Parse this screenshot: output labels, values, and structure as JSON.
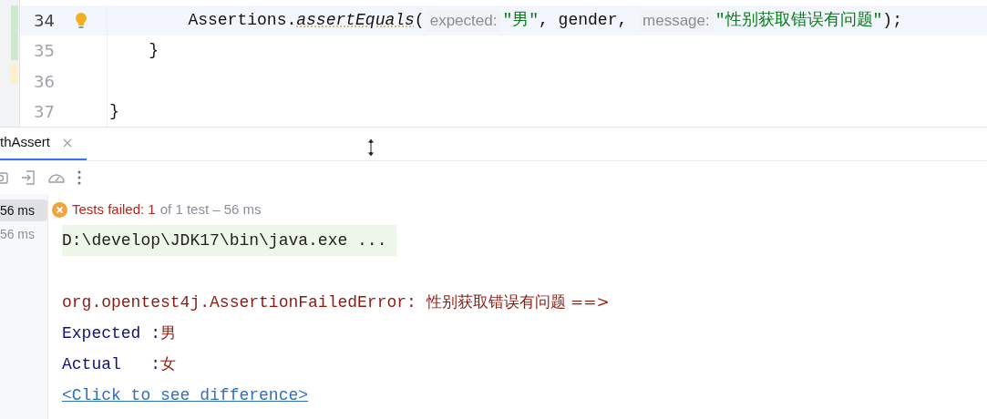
{
  "editor": {
    "lines": [
      {
        "number": "34",
        "current": true,
        "bulb": true,
        "tokens": [
          {
            "kind": "plain",
            "text": "        Assertions."
          },
          {
            "kind": "method",
            "text": "assertEquals"
          },
          {
            "kind": "plain",
            "text": "("
          },
          {
            "kind": "hint",
            "text": "expected:"
          },
          {
            "kind": "string",
            "text": "\"男\""
          },
          {
            "kind": "plain",
            "text": ", gender, "
          },
          {
            "kind": "hint",
            "text": "message:"
          },
          {
            "kind": "string",
            "text": "\"性别获取错误有问题\""
          },
          {
            "kind": "plain",
            "text": ");"
          }
        ]
      },
      {
        "number": "35",
        "current": false,
        "bulb": false,
        "tokens": [
          {
            "kind": "plain",
            "text": "    }"
          }
        ]
      },
      {
        "number": "36",
        "current": false,
        "bulb": false
      },
      {
        "number": "37",
        "current": false,
        "bulb": false,
        "tokens": [
          {
            "kind": "plain",
            "text": "}"
          }
        ]
      }
    ]
  },
  "run_panel": {
    "tabs": [
      {
        "label": "thAssert",
        "selected": true
      }
    ],
    "tree": [
      {
        "time": "56 ms",
        "selected": true
      },
      {
        "time": "56 ms",
        "selected": false
      }
    ],
    "status": {
      "failed": "Tests failed: 1",
      "rest": "of 1 test – 56 ms"
    },
    "console": [
      {
        "kind": "command",
        "text": "D:\\develop\\JDK17\\bin\\java.exe ..."
      },
      {
        "kind": "blank"
      },
      {
        "kind": "error",
        "text": "org.opentest4j.AssertionFailedError: ",
        "message": "性别获取错误有问题 ==>"
      },
      {
        "kind": "pair",
        "label": "Expected :",
        "value": "男"
      },
      {
        "kind": "pair",
        "label": "Actual   :",
        "value": "女"
      },
      {
        "kind": "link",
        "text": "<Click to see difference>"
      }
    ]
  }
}
